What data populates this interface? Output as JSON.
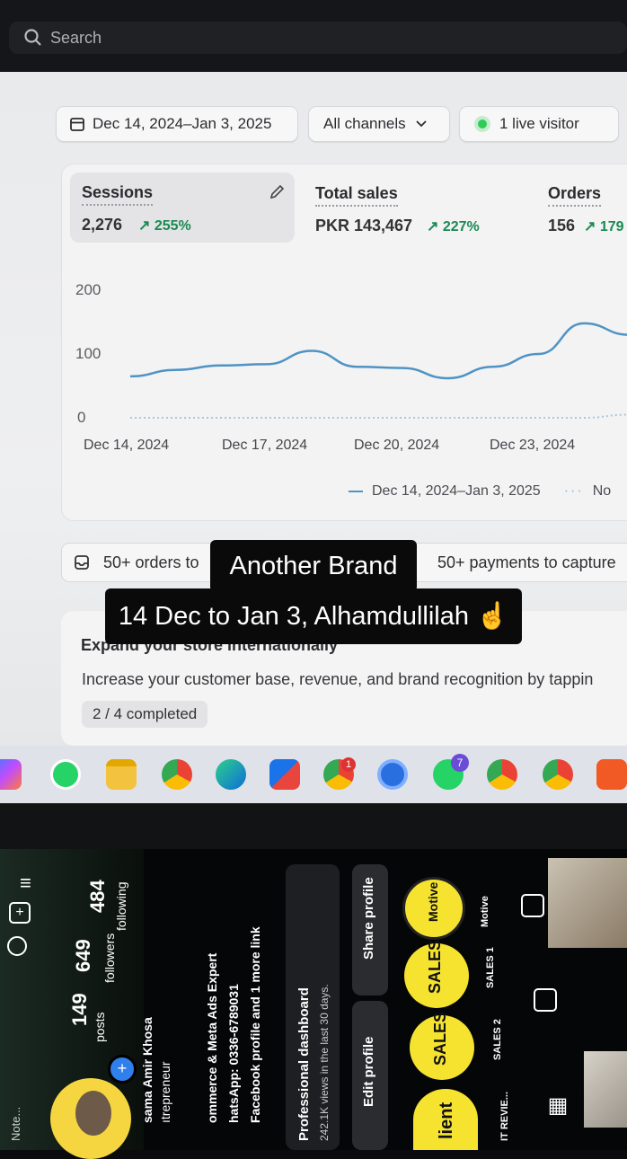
{
  "browser": {
    "search_placeholder": "Search"
  },
  "filters": {
    "date_range": "Dec 14, 2024–Jan 3, 2025",
    "channels": "All channels",
    "live_visitors": "1 live visitor"
  },
  "metrics": [
    {
      "title": "Sessions",
      "value": "2,276",
      "change": "255%"
    },
    {
      "title": "Total sales",
      "value": "PKR 143,467",
      "change": "227%"
    },
    {
      "title": "Orders",
      "value": "156",
      "change": "179"
    }
  ],
  "chart_data": {
    "type": "line",
    "yticks": [
      "200",
      "100",
      "0"
    ],
    "ylim": [
      0,
      200
    ],
    "x": [
      "Dec 14, 2024",
      "Dec 15",
      "Dec 16",
      "Dec 17, 2024",
      "Dec 18",
      "Dec 19",
      "Dec 20, 2024",
      "Dec 21",
      "Dec 22",
      "Dec 23, 2024",
      "Dec 24",
      "Dec 25",
      "Dec 26"
    ],
    "xtick_labels": [
      "Dec 14, 2024",
      "Dec 17, 2024",
      "Dec 20, 2024",
      "Dec 23, 2024"
    ],
    "series": [
      {
        "name": "Dec 14, 2024–Jan 3, 2025",
        "values": [
          65,
          75,
          82,
          84,
          105,
          80,
          78,
          62,
          80,
          100,
          148,
          130,
          115
        ]
      },
      {
        "name": "No",
        "values": [
          0,
          0,
          0,
          0,
          0,
          0,
          0,
          0,
          0,
          0,
          0,
          5,
          18
        ]
      }
    ],
    "legend_position": "bottom",
    "line_color": "#4f93c4"
  },
  "banners": {
    "orders": "50+ orders to",
    "payments": "50+ payments to capture"
  },
  "expand_card": {
    "title": "Expand your store internationally",
    "body": "Increase your customer base, revenue, and brand recognition by tappin",
    "progress": "2 / 4 completed"
  },
  "overlay": {
    "line1": "Another Brand",
    "line2": "14 Dec to Jan 3, Alhamdullilah ☝️"
  },
  "taskbar": {
    "badges": [
      "1",
      "7"
    ]
  },
  "phone": {
    "posts": "149",
    "posts_label": "posts",
    "followers": "649",
    "followers_label": "followers",
    "following": "484",
    "following_label": "following",
    "name": "sama Amir Khosa",
    "bio": [
      "ıtrepreneur",
      "ommerce & Meta Ads Expert",
      "hatsApp: 0336-6789031",
      "Facebook profile and 1 more link"
    ],
    "dashboard_title": "Professional dashboard",
    "dashboard_sub": "242.1K views in the last 30 days.",
    "edit_profile": "Edit profile",
    "share_profile": "Share profile",
    "highlights": [
      "Motive",
      "SALES 1",
      "SALES 2",
      "IT REVIE..."
    ],
    "highlight_texts": [
      "Motive",
      "SALES",
      "SALES",
      "lient"
    ],
    "note": "Note..."
  }
}
